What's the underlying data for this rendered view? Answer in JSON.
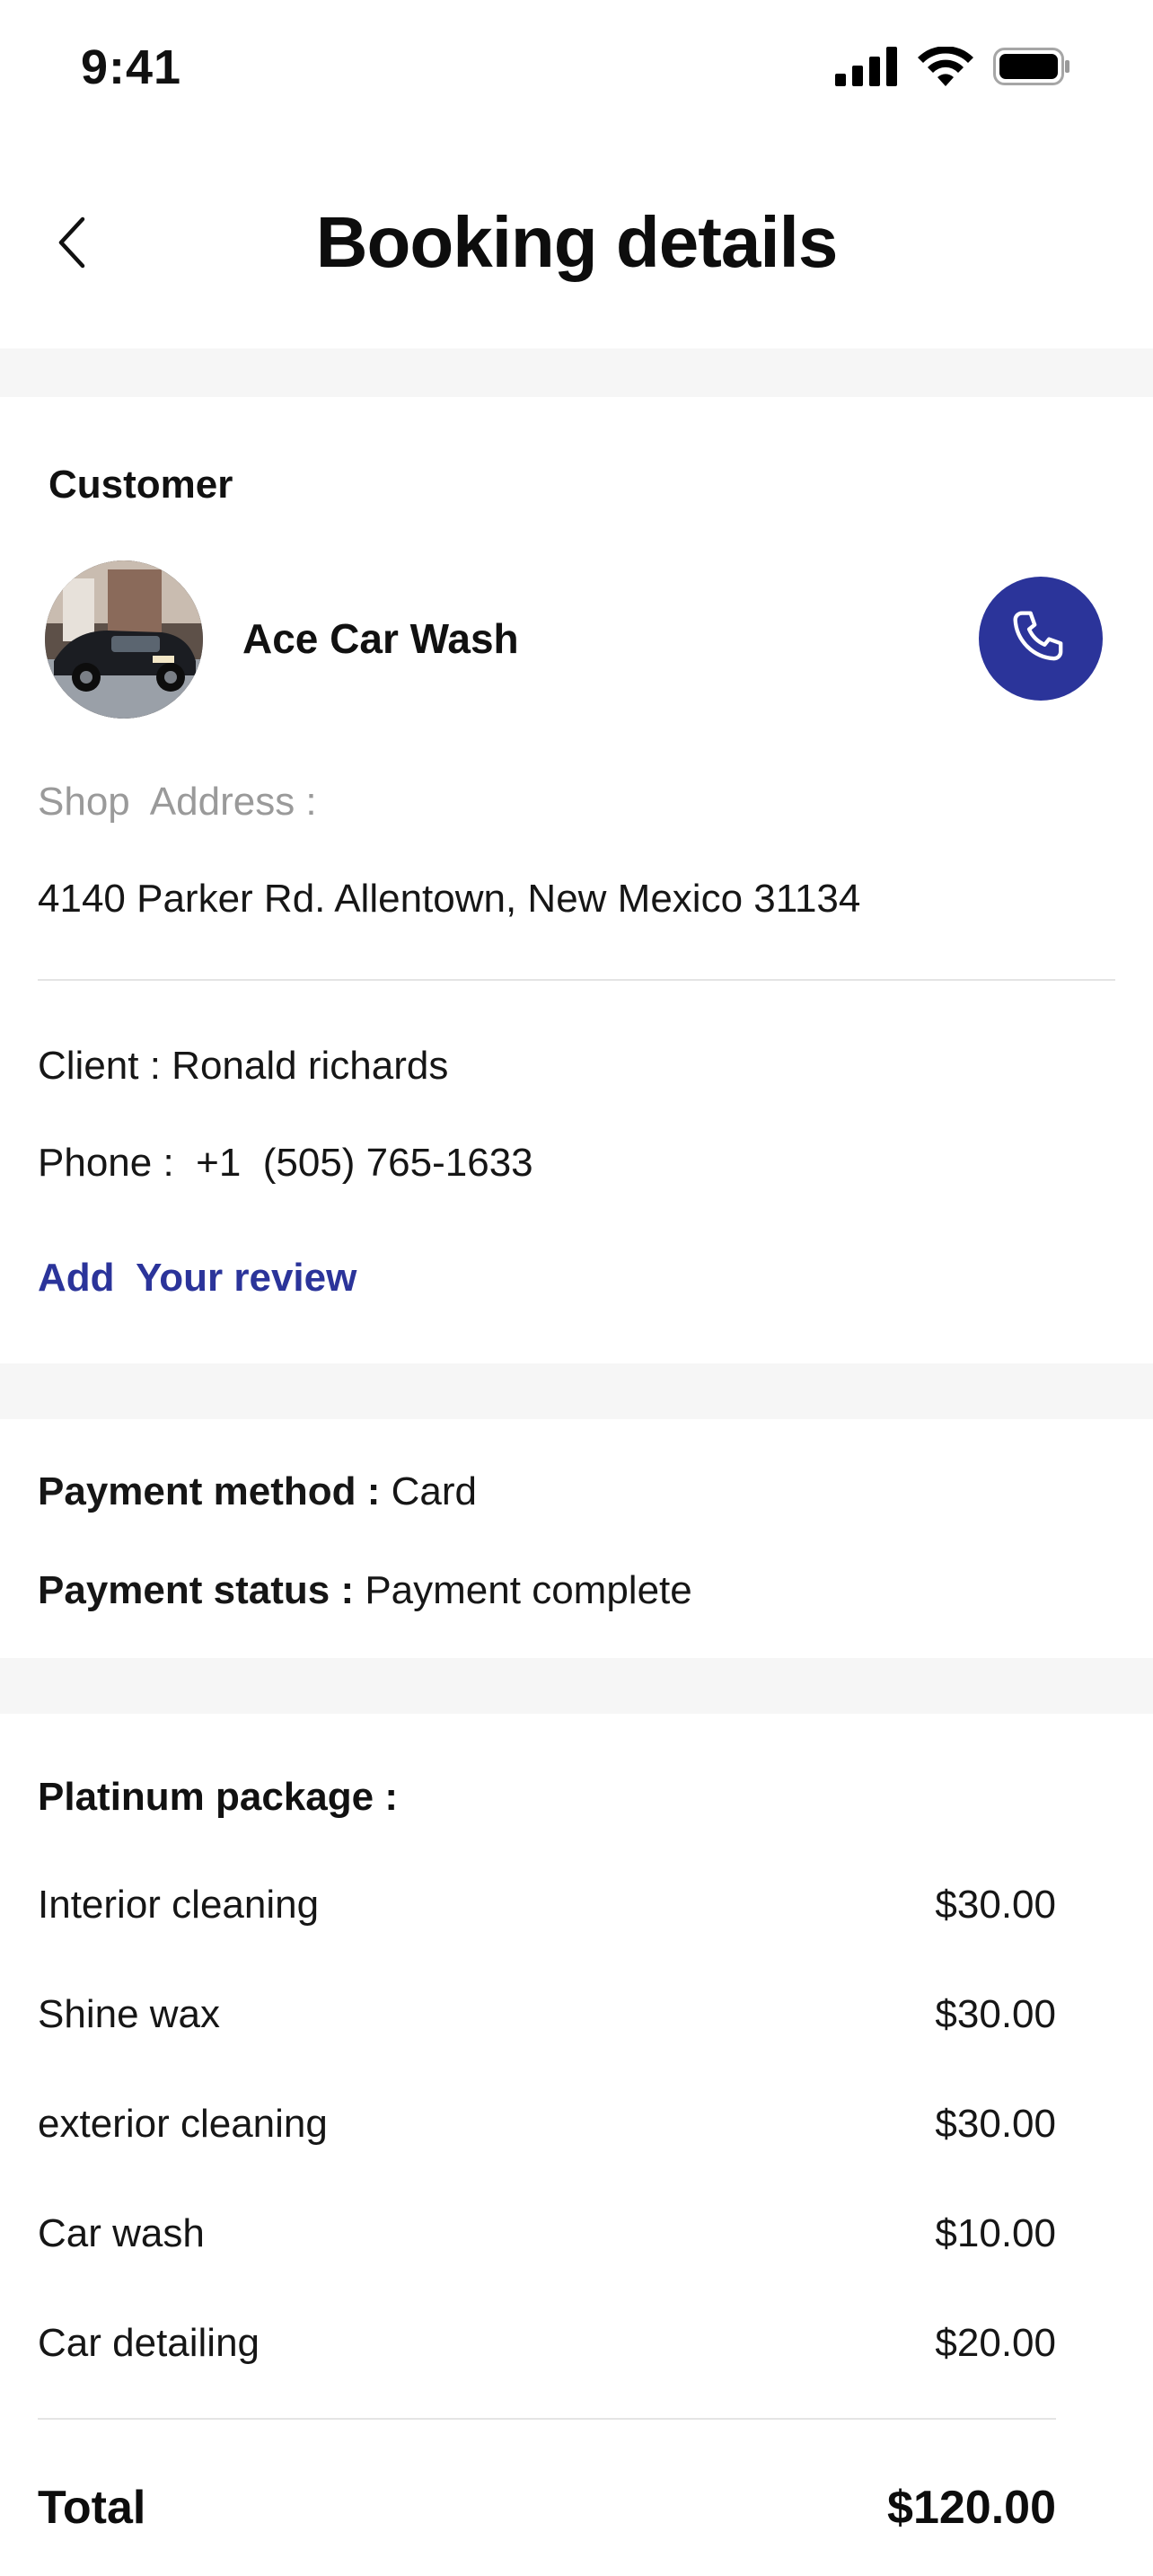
{
  "status_bar": {
    "time": "9:41",
    "icons": [
      "cellular-signal-icon",
      "wifi-icon",
      "battery-icon"
    ]
  },
  "header": {
    "back_icon": "chevron-left-icon",
    "title": "Booking details"
  },
  "customer": {
    "heading": "Customer",
    "shop_name": "Ace Car Wash",
    "call_icon": "phone-icon",
    "address_label": "Shop  Address :",
    "address": "4140 Parker Rd. Allentown, New Mexico 31134",
    "client_text": "Client : Ronald richards",
    "phone_text": "Phone :  +1  (505) 765-1633",
    "review_link": "Add  Your review"
  },
  "payment": {
    "method_label": "Payment method :",
    "method_value": " Card",
    "status_label": "Payment status :",
    "status_value": " Payment complete"
  },
  "package": {
    "title": "Platinum package :",
    "items": [
      {
        "name": "Interior cleaning",
        "price": "$30.00"
      },
      {
        "name": "Shine wax",
        "price": "$30.00"
      },
      {
        "name": "exterior cleaning",
        "price": "$30.00"
      },
      {
        "name": "Car wash",
        "price": "$10.00"
      },
      {
        "name": "Car detailing",
        "price": "$20.00"
      }
    ],
    "total_label": "Total",
    "total_value": "$120.00"
  },
  "colors": {
    "accent": "#2b349a",
    "section_gap": "#f6f6f6",
    "muted_text": "#9a9a9a"
  }
}
